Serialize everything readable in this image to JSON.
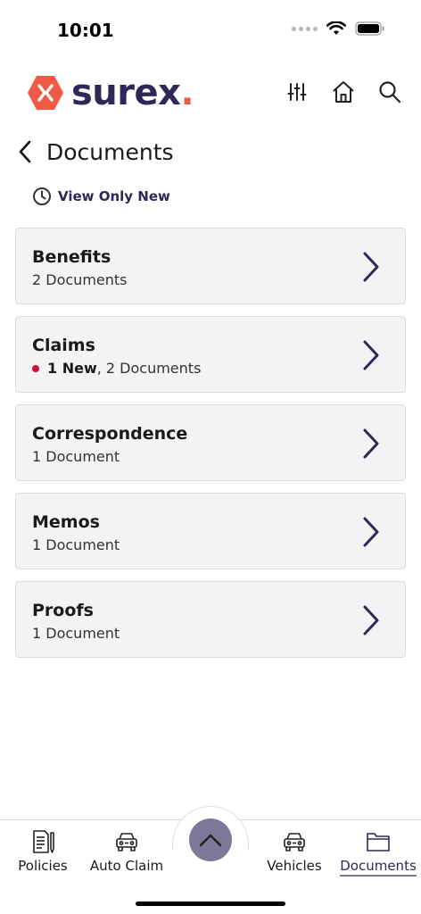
{
  "status_bar": {
    "time": "10:01"
  },
  "header": {
    "logo_text": "surex",
    "logo_dot": ".",
    "icons": [
      "sliders-icon",
      "home-icon",
      "search-icon"
    ]
  },
  "page": {
    "title": "Documents"
  },
  "filter": {
    "label": "View Only New"
  },
  "categories": [
    {
      "title": "Benefits",
      "subtitle": "2 Documents",
      "new": ""
    },
    {
      "title": "Claims",
      "subtitle": ", 2 Documents",
      "new": "1 New"
    },
    {
      "title": "Correspondence",
      "subtitle": "1 Document",
      "new": ""
    },
    {
      "title": "Memos",
      "subtitle": "1 Document",
      "new": ""
    },
    {
      "title": "Proofs",
      "subtitle": "1 Document",
      "new": ""
    }
  ],
  "tabs": [
    {
      "label": "Policies",
      "icon": "policy-document-icon"
    },
    {
      "label": "Auto Claim",
      "icon": "car-icon"
    },
    {
      "label": "Vehicles",
      "icon": "car-icon"
    },
    {
      "label": "Documents",
      "icon": "folder-icon",
      "active": true
    }
  ],
  "colors": {
    "brand": "#2e2856",
    "accent": "#f05a44",
    "new_dot": "#d0103a",
    "fab": "#7c7898"
  }
}
